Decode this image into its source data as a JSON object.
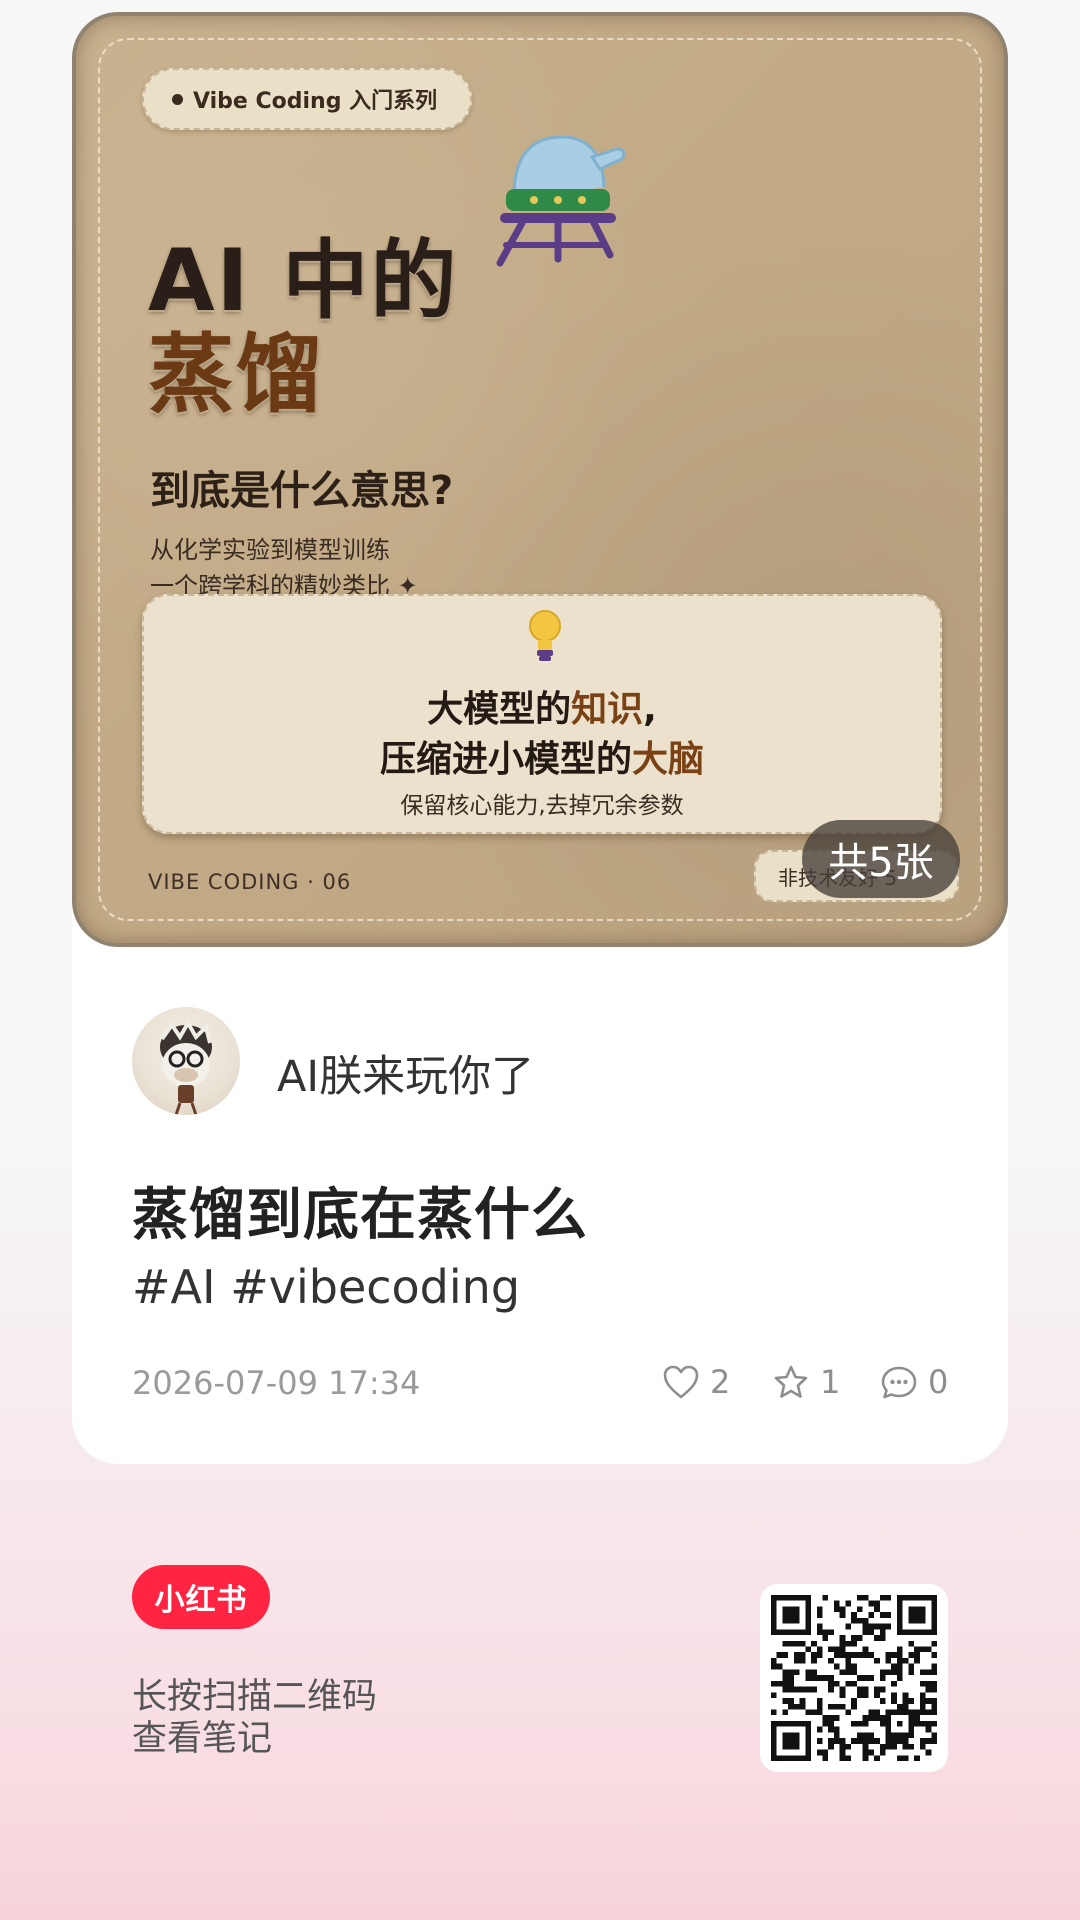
{
  "cover": {
    "series_label": "Vibe Coding 入门系列",
    "title_line1": "AI 中的",
    "title_line2": "蒸馏",
    "question": "到底是什么意思?",
    "subtitle_line1": "从化学实验到模型训练",
    "subtitle_line2": "一个跨学科的精妙类比 ✦",
    "quote": {
      "line1_prefix": "大模型的",
      "line1_accent": "知识",
      "line1_suffix": ",",
      "line2_prefix": "压缩进小模型的",
      "line2_accent": "大脑",
      "caption": "保留核心能力,去掉冗余参数"
    },
    "footer_label": "VIBE CODING · 06",
    "corner_badge": "非技术友好 5",
    "image_count": "共5张"
  },
  "author": {
    "name": "AI朕来玩你了"
  },
  "post": {
    "title": "蒸馏到底在蒸什么",
    "tags": "#AI #vibecoding",
    "date": "2026-07-09 17:34",
    "likes": "2",
    "favorites": "1",
    "comments": "0"
  },
  "footer": {
    "brand": "小红书",
    "scan_line1": "长按扫描二维码",
    "scan_line2": "查看笔记"
  },
  "colors": {
    "brand_red": "#ff2442",
    "felt_base": "#c2aa86",
    "accent_brown": "#6b3a14"
  }
}
